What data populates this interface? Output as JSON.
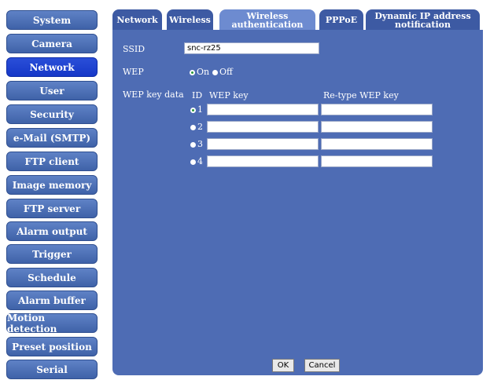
{
  "sidebar": {
    "items": [
      {
        "label": "System"
      },
      {
        "label": "Camera"
      },
      {
        "label": "Network"
      },
      {
        "label": "User"
      },
      {
        "label": "Security"
      },
      {
        "label": "e-Mail (SMTP)"
      },
      {
        "label": "FTP client"
      },
      {
        "label": "Image memory"
      },
      {
        "label": "FTP server"
      },
      {
        "label": "Alarm output"
      },
      {
        "label": "Trigger"
      },
      {
        "label": "Schedule"
      },
      {
        "label": "Alarm buffer"
      },
      {
        "label": "Motion detection"
      },
      {
        "label": "Preset position"
      },
      {
        "label": "Serial"
      }
    ],
    "active": "Network"
  },
  "tabs": [
    {
      "label": "Network"
    },
    {
      "label": "Wireless"
    },
    {
      "label": "Wireless authentication"
    },
    {
      "label": "PPPoE"
    },
    {
      "label": "Dynamic IP address notification"
    }
  ],
  "form": {
    "ssid_label": "SSID",
    "ssid_value": "snc-rz25",
    "wep_label": "WEP",
    "wep_on": "On",
    "wep_off": "Off",
    "wep_key_data_label": "WEP key data",
    "id_header": "ID",
    "wep_key_header": "WEP key",
    "retype_header": "Re-type WEP key",
    "keys": [
      {
        "id": "1",
        "key": "",
        "retype": "",
        "selected": true
      },
      {
        "id": "2",
        "key": "",
        "retype": "",
        "selected": false
      },
      {
        "id": "3",
        "key": "",
        "retype": "",
        "selected": false
      },
      {
        "id": "4",
        "key": "",
        "retype": "",
        "selected": false
      }
    ]
  },
  "buttons": {
    "ok": "OK",
    "cancel": "Cancel"
  },
  "colors": {
    "panel": "#4e6cb4",
    "sidebar_button": "#4f72b8",
    "active_button": "#1f44d0"
  }
}
